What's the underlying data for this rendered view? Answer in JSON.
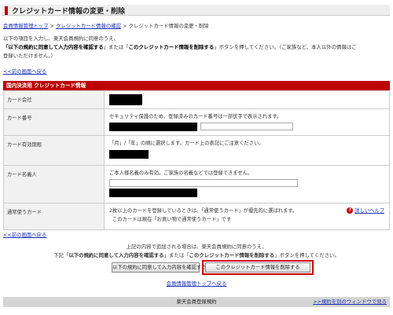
{
  "page": {
    "title": "クレジットカード情報の変更・削除"
  },
  "breadcrumb": {
    "item1": "会員情報管理トップ",
    "sep": " > ",
    "item2": "クレジットカード情報の確認",
    "current": "クレジットカード情報の変更・削除"
  },
  "intro": {
    "line1": "以下の項目を入力し、楽天会員規約に同意のうえ、",
    "line2_bold1": "「以下の規約に同意して入力内容を確認する",
    "line2_mid": "」または「",
    "line2_bold2": "このクレジットカード情報を削除する",
    "line2_end": "」ボタンを押してください。（ご家族など、本人以外の情報はご",
    "line3": "登録いただけません。）"
  },
  "back_link": "<<前の画面へ戻る",
  "section": {
    "title": "国内決済用 クレジットカード情報"
  },
  "form": {
    "card_company_label": "カード会社",
    "card_number_label": "カード番号",
    "card_number_note": "セキュリティ保護のため、登録済みのカード番号は一部伏字で表示されます。",
    "expiry_label": "カード有効期限",
    "expiry_note": "「月」/「年」の順に選択します。カード上の表記にご注意ください。",
    "holder_label": "カード名義人",
    "holder_note": "ご本人様名義のみ有効。ご家族の名義などでは登録できません。",
    "default_card_label": "通常使うカード",
    "default_note1": "2枚以上のカードを登録しているときは、「通常使うカード」が優先的に選ばれます。",
    "default_note2": "このカードは現在「お買い物で通常使うカード」です",
    "help_link": "詳しいヘルプ"
  },
  "bottom": {
    "back_link": "<<前の画面へ戻る",
    "line1": "上記の内容で追加される場合は、楽天会員規約に同意のうえ、",
    "line2_pre": "下記「",
    "line2_bold1": "以下の規約に同意して入力内容を確認する",
    "line2_mid": "」または「",
    "line2_bold2": "このクレジットカード情報を削除する",
    "line2_end": "」ボタンを押してください。",
    "confirm_button": "以下の規約に同意して入力内容を確認する",
    "delete_button": "このクレジットカード情報を削除する",
    "back_top_link": "会員情報管理トップへ戻る"
  },
  "footer": {
    "title": "楽天会員登録規約",
    "new_window_link": ">>規約を別のウィンドウで見る"
  },
  "colors": {
    "brand_red": "#bf0000",
    "link_blue": "#1a2fb8"
  }
}
